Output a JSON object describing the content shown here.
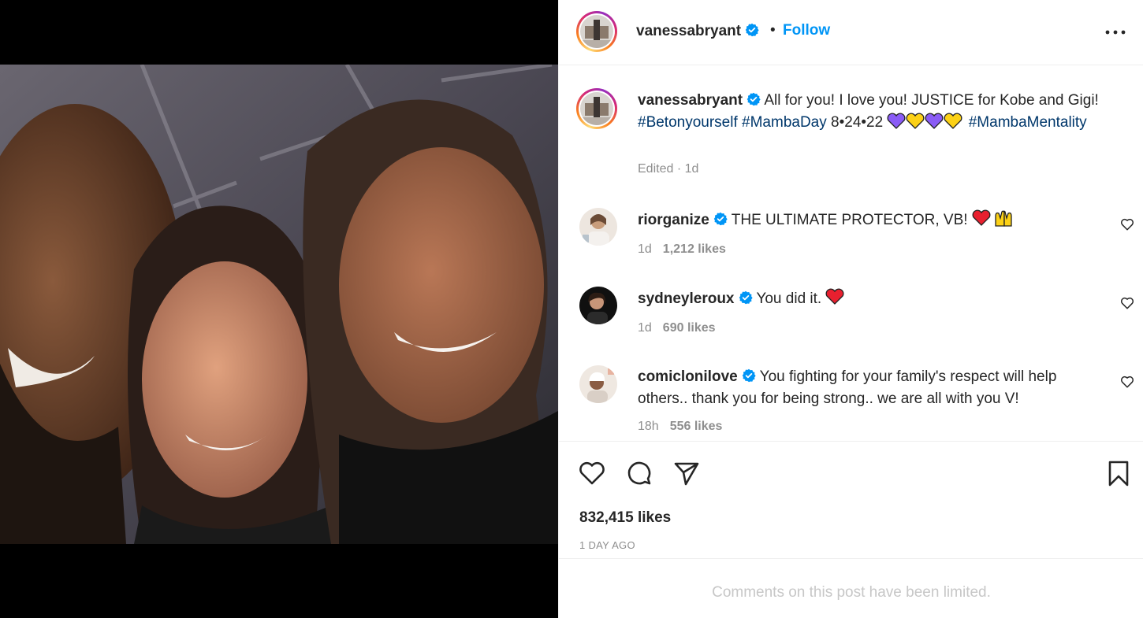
{
  "post": {
    "author": "vanessabryant",
    "follow_label": "Follow",
    "separator": "•",
    "caption": {
      "username": "vanessabryant",
      "text": "All for you! I love you! JUSTICE for Kobe and Gigi!",
      "tags": [
        "#Betonyourself",
        "#MambaDay",
        "#MambaMentality"
      ],
      "date_text": "8•24•22",
      "emoji": [
        "purple-heart",
        "yellow-heart",
        "purple-heart",
        "yellow-heart"
      ],
      "meta": "Edited · 1d"
    },
    "likes": "832,415 likes",
    "time": "1 DAY AGO",
    "comments_limited": "Comments on this post have been limited."
  },
  "comments": [
    {
      "username": "riorganize",
      "text": "THE ULTIMATE PROTECTOR, VB!",
      "emoji": [
        "red-heart",
        "raising-hands"
      ],
      "age": "1d",
      "likes": "1,212 likes"
    },
    {
      "username": "sydneyleroux",
      "text": "You did it.",
      "emoji": [
        "red-heart"
      ],
      "age": "1d",
      "likes": "690 likes"
    },
    {
      "username": "comiclonilove",
      "text": "You fighting for your family's respect will help others.. thank you for being strong.. we are all with you V!",
      "emoji": [],
      "age": "18h",
      "likes": "556 likes"
    }
  ],
  "colors": {
    "accent": "#0095f6",
    "hashtag": "#00376b",
    "muted": "#8e8e8e",
    "verified": "#0095f6"
  },
  "icons": [
    "more-icon",
    "verified-icon",
    "heart-icon",
    "comment-icon",
    "share-icon",
    "bookmark-icon"
  ]
}
